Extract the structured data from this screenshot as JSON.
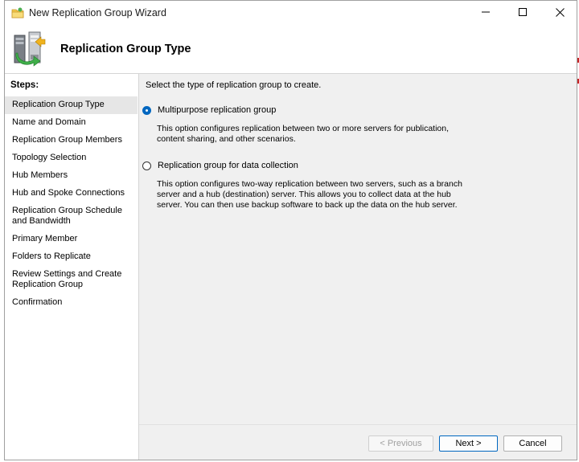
{
  "window": {
    "title": "New Replication Group Wizard",
    "controls": {
      "minimize_icon": "minimize-icon",
      "maximize_icon": "maximize-icon",
      "close_icon": "close-icon"
    }
  },
  "header": {
    "title": "Replication Group Type",
    "icon": "replication-servers-icon"
  },
  "steps": {
    "label": "Steps:",
    "items": [
      {
        "label": "Replication Group Type",
        "active": true
      },
      {
        "label": "Name and Domain"
      },
      {
        "label": "Replication Group Members"
      },
      {
        "label": "Topology Selection"
      },
      {
        "label": "Hub Members"
      },
      {
        "label": "Hub and Spoke Connections"
      },
      {
        "label": "Replication Group Schedule and Bandwidth"
      },
      {
        "label": "Primary Member"
      },
      {
        "label": "Folders to Replicate"
      },
      {
        "label": "Review Settings and Create Replication Group"
      },
      {
        "label": "Confirmation"
      }
    ]
  },
  "content": {
    "prompt": "Select the type of replication group to create.",
    "options": [
      {
        "label": "Multipurpose replication group",
        "selected": true,
        "description": "This option configures replication between two or more servers for publication, content sharing, and other scenarios."
      },
      {
        "label": "Replication group for data collection",
        "selected": false,
        "description": "This option configures two-way replication between two servers, such as a branch server and a hub (destination) server. This allows you to collect data at the hub server. You can then use backup software to back up the data on the hub server."
      }
    ]
  },
  "footer": {
    "previous_label": "< Previous",
    "next_label": "Next >",
    "cancel_label": "Cancel"
  },
  "colors": {
    "accent": "#0067c0",
    "window_bg": "#f0f0f0",
    "banner_bg": "#ffffff"
  }
}
